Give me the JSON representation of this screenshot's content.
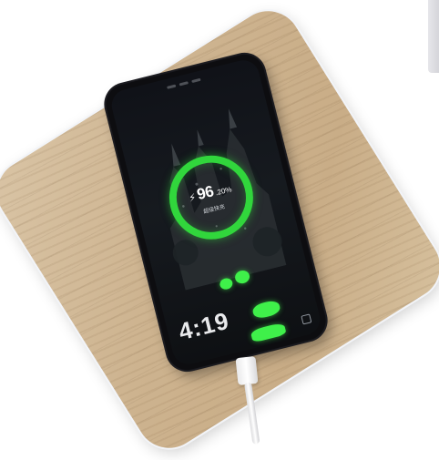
{
  "phone": {
    "charge_percent_main": "96",
    "charge_percent_decimal": ".20%",
    "charge_status": "超级快充",
    "clock_time": "4:19",
    "charge_level": 96.2,
    "ring_color": "#31d63c"
  },
  "icons": {
    "bolt": "lightning-bolt-icon",
    "camera": "camera-shortcut-icon"
  }
}
